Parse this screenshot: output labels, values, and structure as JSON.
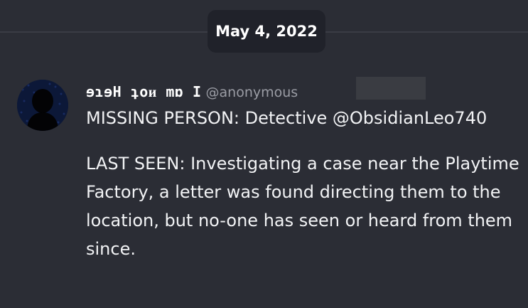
{
  "date_divider": {
    "label": "May 4, 2022"
  },
  "message": {
    "author": {
      "display_name": "ɘɿɘH ʇoᴎ mɒ I",
      "username": "@anonymous"
    },
    "paragraphs": [
      "MISSING PERSON: Detective @ObsidianLeo740",
      "LAST SEEN: Investigating a case near the Playtime Factory, a letter was found directing them to the location, but no-one has seen or heard from them since."
    ]
  },
  "colors": {
    "background": "#2b2d35",
    "pill_background": "#20222a",
    "divider": "#3a3c45",
    "text_primary": "#f2f3f5",
    "text_muted": "#9a9ca4",
    "redaction": "#3a3c42",
    "avatar_background": "#0c1838"
  },
  "icons": {
    "avatar": "silhouette-avatar-icon"
  }
}
